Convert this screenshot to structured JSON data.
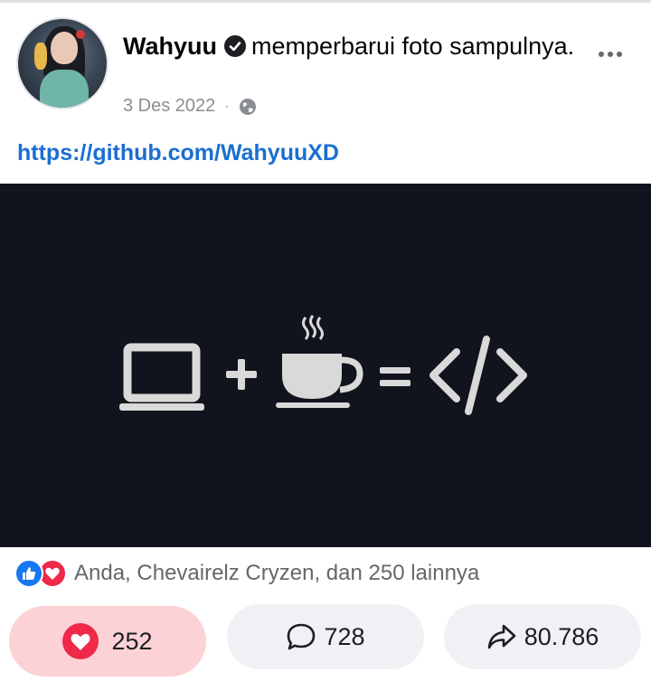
{
  "post": {
    "author_name": "Wahyuu",
    "action_text": "memperbarui foto sampulnya.",
    "date": "3 Des 2022",
    "separator": "·",
    "privacy_icon": "globe-icon",
    "link_text": "https://github.com/WahyuuXD"
  },
  "cover_image": {
    "description_icons": [
      "laptop-icon",
      "plus-icon",
      "coffee-cup-icon",
      "equals-icon",
      "code-tag-icon"
    ],
    "background_color": "#11141c",
    "icon_color": "#d9d9d9"
  },
  "reactions": {
    "icons": [
      "like-icon",
      "love-icon"
    ],
    "summary_text": "Anda, Chevairelz Cryzen, dan 250 lainnya"
  },
  "actions": {
    "react_count": "252",
    "comment_count": "728",
    "share_count": "80.786"
  },
  "colors": {
    "link": "#1a6fd1",
    "love": "#f02849",
    "like": "#1877f2",
    "react_button_bg": "#fcd2d6",
    "button_bg": "#eff1f4"
  }
}
